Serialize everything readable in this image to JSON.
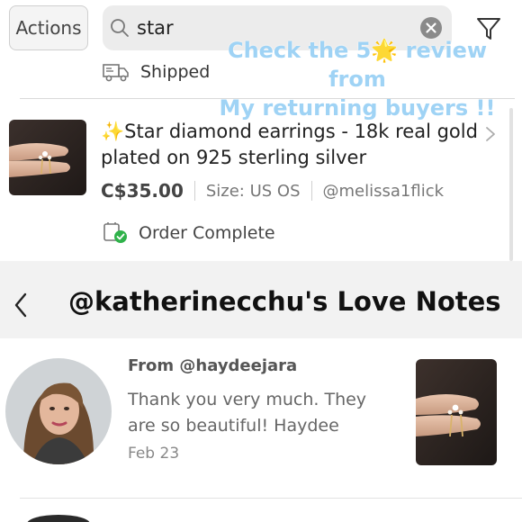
{
  "header": {
    "actions_label": "Actions",
    "search_value": "star"
  },
  "overlay": {
    "line1": "Check the 5🌟 review from",
    "line2": "My returning buyers !!"
  },
  "shipment": {
    "label": "Shipped"
  },
  "order": {
    "title": "✨Star diamond earrings - 18k real gold plated on 925 sterling silver",
    "price": "C$35.00",
    "size": "Size: US OS",
    "seller": "@melissa1flick",
    "status": "Order Complete",
    "status_color": "#2fb24a"
  },
  "love_notes": {
    "title": "@katherinecchu's Love Notes",
    "note": {
      "from": "From @haydeejara",
      "body": "Thank you very much. They are so beautiful! Haydee",
      "date": "Feb 23"
    }
  },
  "icons": [
    "search-icon",
    "clear-icon",
    "filter-icon",
    "truck-icon",
    "order-complete-icon",
    "chevron-right-icon",
    "back-icon"
  ],
  "colors": {
    "overlay_text": "#9fd3f5",
    "header_band": "#f2f2f2"
  }
}
